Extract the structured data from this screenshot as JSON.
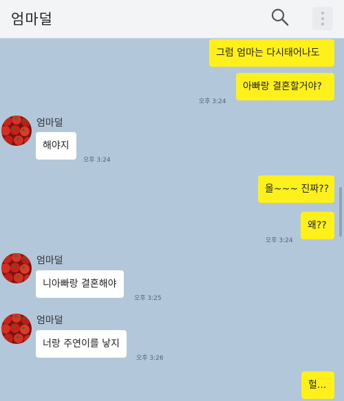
{
  "header": {
    "title": "엄마덜",
    "search_icon": "search-icon",
    "menu_icon": "more-vert-icon"
  },
  "messages": [
    {
      "from": "me",
      "text": "그럼 엄마는 다시태어나도"
    },
    {
      "from": "me",
      "text": "아빠랑 결혼할거야?",
      "time": "오후 3:24"
    },
    {
      "from": "other",
      "sender": "엄마덜",
      "text": "해야지",
      "time": "오후 3:24"
    },
    {
      "from": "me",
      "text": "올~~~ 진짜??"
    },
    {
      "from": "me",
      "text": "왜??",
      "time": "오후 3:24"
    },
    {
      "from": "other",
      "sender": "엄마덜",
      "text": "니아빠랑 결혼해야",
      "time": "오후 3:25"
    },
    {
      "from": "other",
      "sender": "엄마덜",
      "text": "너랑 주연이를 낳지",
      "time": "오후 3:26"
    },
    {
      "from": "me",
      "text": "헐..."
    }
  ],
  "colors": {
    "background": "#b2c7d9",
    "my_bubble": "#fef01b",
    "other_bubble": "#ffffff",
    "header": "#f3f4f6"
  }
}
